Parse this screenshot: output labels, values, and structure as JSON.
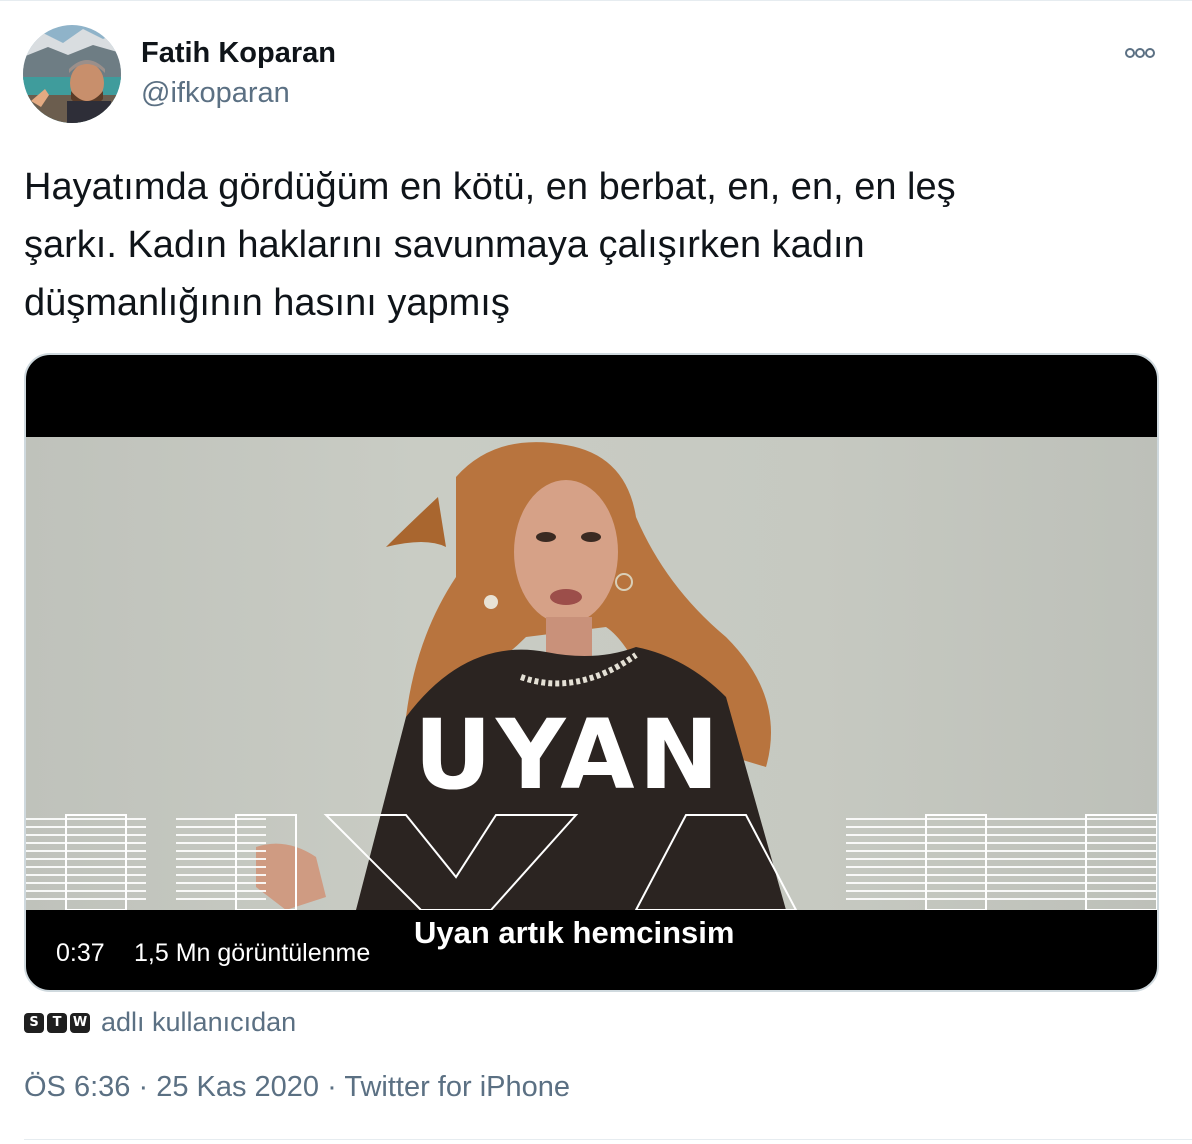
{
  "author": {
    "name": "Fatih Koparan",
    "handle": "@ifkoparan"
  },
  "tweet": {
    "text_lines": [
      "Hayatımda gördüğüm en kötü, en berbat, en, en, en leş",
      "şarkı. Kadın haklarını savunmaya çalışırken kadın",
      "düşmanlığının hasını yapmış"
    ]
  },
  "media": {
    "overlay_title": "UYAN",
    "caption": "Uyan artık hemcinsim",
    "duration": "0:37",
    "views": "1,5 Mn görüntülenme"
  },
  "attribution": {
    "badges": [
      "S",
      "T",
      "W"
    ],
    "text": "adlı kullanıcıdan"
  },
  "meta": {
    "time": "ÖS 6:36",
    "date": "25 Kas 2020",
    "source": "Twitter for iPhone",
    "separator": "·"
  },
  "colors": {
    "secondary_text": "#5b7083",
    "primary_text": "#0f1419",
    "media_border": "#cfd9de"
  },
  "icons": {
    "more": "more-dots-icon"
  }
}
